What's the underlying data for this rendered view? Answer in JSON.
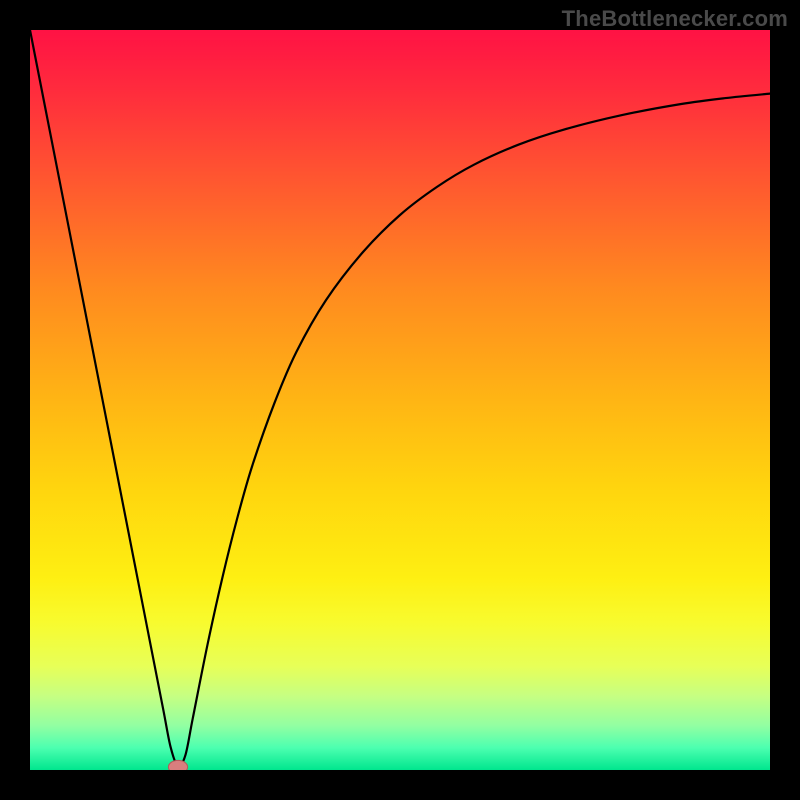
{
  "watermark": "TheBottleneсker.com",
  "chart_data": {
    "type": "line",
    "title": "",
    "xlabel": "",
    "ylabel": "",
    "xlim": [
      0,
      100
    ],
    "ylim": [
      0,
      100
    ],
    "grid": false,
    "background_gradient": {
      "stops": [
        {
          "offset": 0.0,
          "color": "#ff1244"
        },
        {
          "offset": 0.08,
          "color": "#ff2b3d"
        },
        {
          "offset": 0.2,
          "color": "#ff5630"
        },
        {
          "offset": 0.35,
          "color": "#ff8a1f"
        },
        {
          "offset": 0.5,
          "color": "#ffb514"
        },
        {
          "offset": 0.62,
          "color": "#ffd50e"
        },
        {
          "offset": 0.74,
          "color": "#feef12"
        },
        {
          "offset": 0.8,
          "color": "#f8fb2e"
        },
        {
          "offset": 0.86,
          "color": "#e7ff58"
        },
        {
          "offset": 0.9,
          "color": "#c6ff82"
        },
        {
          "offset": 0.94,
          "color": "#92ffa2"
        },
        {
          "offset": 0.97,
          "color": "#4cffb0"
        },
        {
          "offset": 1.0,
          "color": "#00e68e"
        }
      ]
    },
    "series": [
      {
        "name": "bottleneck-curve",
        "stroke": "#000000",
        "stroke_width": 2.2,
        "x": [
          0,
          2,
          4,
          6,
          8,
          10,
          12,
          14,
          16,
          18,
          19,
          20,
          21,
          22,
          24,
          26,
          28,
          30,
          33,
          36,
          40,
          45,
          50,
          55,
          60,
          66,
          72,
          80,
          88,
          94,
          100
        ],
        "y": [
          100,
          89.8,
          79.6,
          69.4,
          59.2,
          49.0,
          38.8,
          28.6,
          18.4,
          8.2,
          3.1,
          0.5,
          2.0,
          7.0,
          17.0,
          26.0,
          34.0,
          41.0,
          49.5,
          56.5,
          63.5,
          70.0,
          75.0,
          78.8,
          81.8,
          84.5,
          86.5,
          88.5,
          90.0,
          90.8,
          91.4
        ]
      }
    ],
    "marker": {
      "name": "optimal-point",
      "x": 20,
      "y": 0.4,
      "rx": 1.3,
      "ry": 0.9,
      "fill": "#d97e7e",
      "stroke": "#b35a5a"
    }
  }
}
